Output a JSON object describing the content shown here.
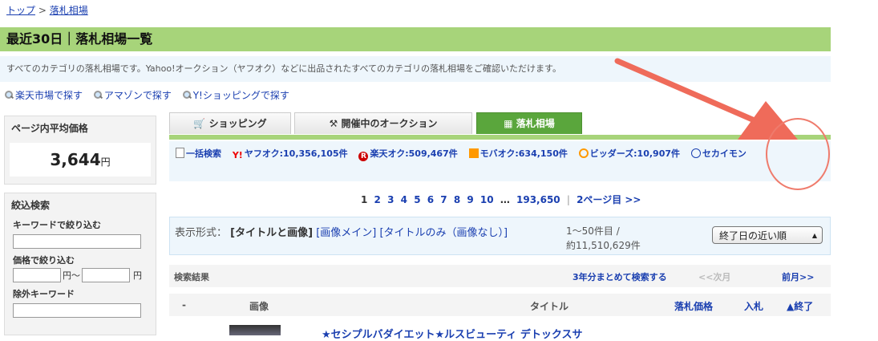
{
  "breadcrumb": {
    "home": "トップ",
    "sep": ">",
    "current": "落札相場"
  },
  "page_title": "最近30日｜落札相場一覧",
  "description": "すべてのカテゴリの落札相場です。Yahoo!オークション（ヤフオク）などに出品されたすべてのカテゴリの落札相場をご確認いただけます。",
  "search_links": [
    "楽天市場で探す",
    "アマゾンで探す",
    "Y!ショッピングで探す"
  ],
  "avg_box": {
    "title": "ページ内平均価格",
    "value": "3,644",
    "unit": "円"
  },
  "filter_box": {
    "title": "絞込検索",
    "keyword_label": "キーワードで絞り込む",
    "price_label": "価格で絞り込む",
    "price_unit_from": "円〜",
    "price_unit_to": "円",
    "exclude_label": "除外キーワード"
  },
  "tabs": [
    {
      "label": "ショッピング",
      "icon": "cart-icon"
    },
    {
      "label": "開催中のオークション",
      "icon": "gavel-icon"
    },
    {
      "label": "落札相場",
      "icon": "grid-icon",
      "active": true
    }
  ],
  "counts": {
    "bulk": "一括検索",
    "yahoo": "ヤフオク:10,356,105件",
    "rakuten": "楽天オク:509,467件",
    "mobaoku": "モバオク:634,150件",
    "bidders": "ビッダーズ:10,907件",
    "sekaimon": "セカイモン"
  },
  "pager": {
    "pages": [
      "1",
      "2",
      "3",
      "4",
      "5",
      "6",
      "7",
      "8",
      "9",
      "10"
    ],
    "ellipsis": "…",
    "last": "193,650",
    "next": "2ページ目 >>"
  },
  "view": {
    "label": "表示形式：",
    "opt_current": "[タイトルと画像]",
    "opt_image": "[画像メイン]",
    "opt_title": "[タイトルのみ（画像なし）]",
    "range": "1〜50件目 /",
    "total": "約11,510,629件",
    "sort": "終了日の近い順"
  },
  "results_bar": {
    "label": "検索結果",
    "three_year": "3年分まとめて検索する",
    "next_month": "<<次月",
    "prev_month": "前月>>"
  },
  "table_head": {
    "dash": "-",
    "image": "画像",
    "title": "タイトル",
    "price": "落札価格",
    "bids": "入札",
    "end": "▲終了"
  },
  "first_row_title": "★セシプルバダイエット★ルスビューティ デトックスサ"
}
